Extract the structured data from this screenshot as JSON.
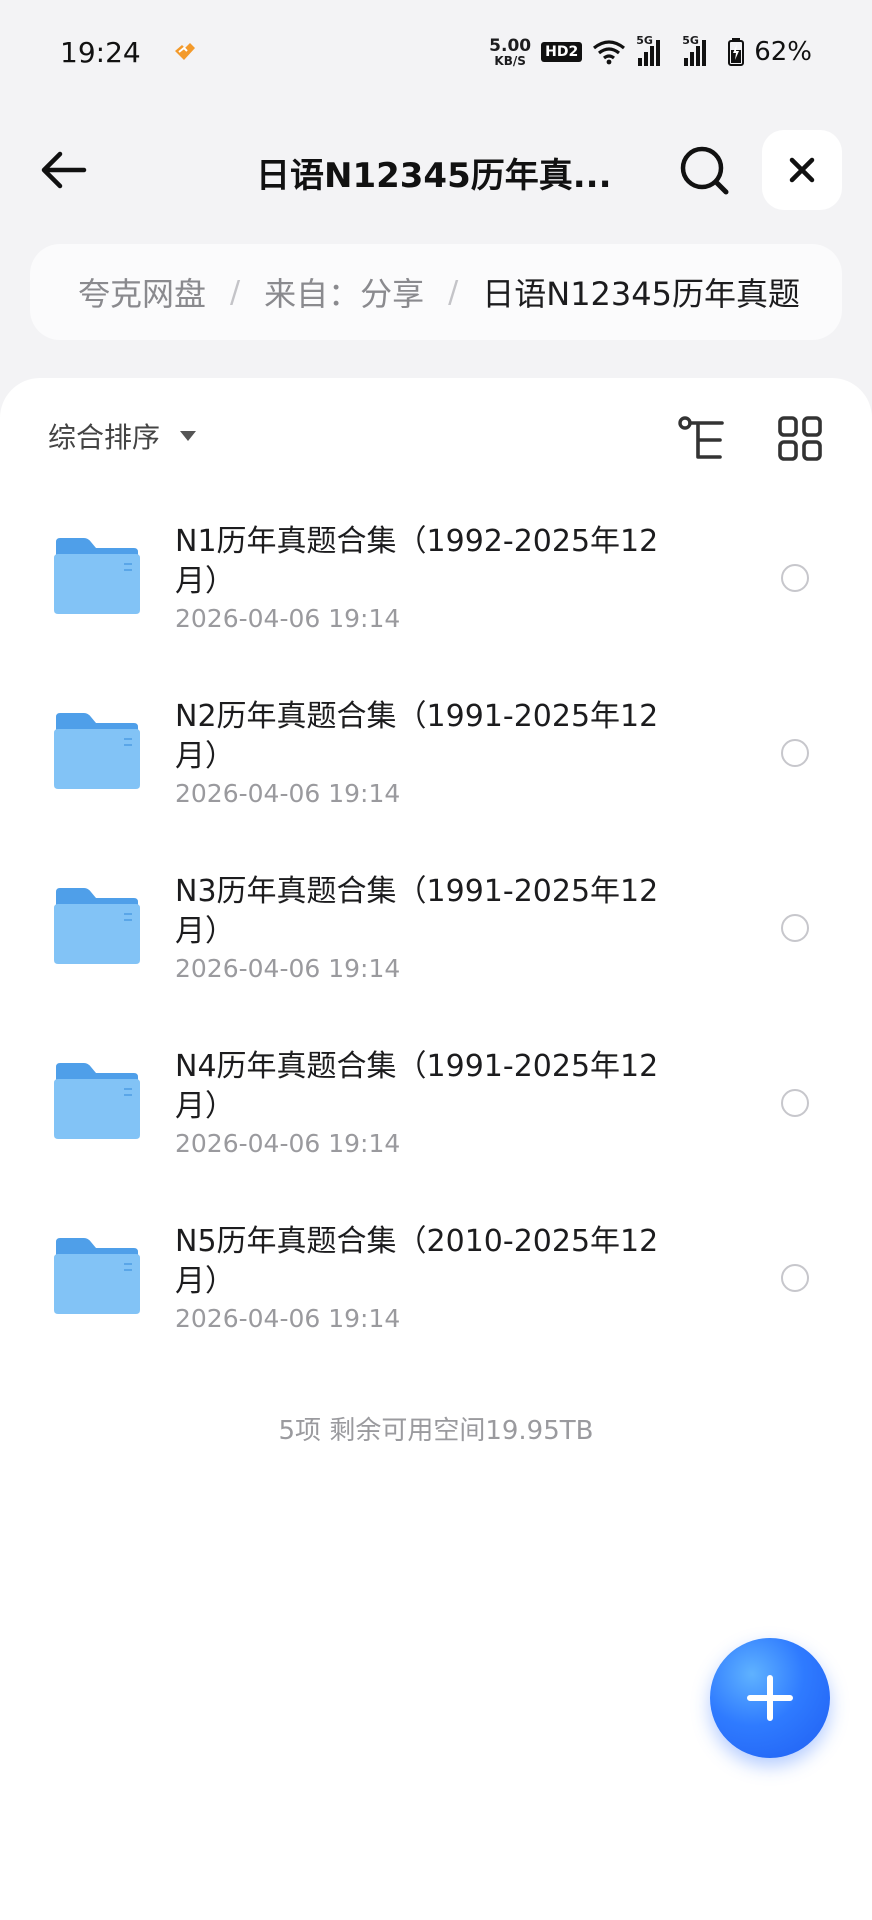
{
  "status_bar": {
    "time": "19:24",
    "net_speed_value": "5.00",
    "net_speed_unit": "KB/S",
    "hd_badge": "HD2",
    "signal1_label": "5G",
    "signal2_label": "5G",
    "battery_percent": "62%"
  },
  "header": {
    "title": "日语N12345历年真..."
  },
  "breadcrumb": {
    "items": [
      "夸克网盘",
      "来自：分享",
      "日语N12345历年真题"
    ],
    "separator": "/"
  },
  "toolbar": {
    "sort_label": "综合排序"
  },
  "files": [
    {
      "name": "N1历年真题合集（1992-2025年12月）",
      "date": "2026-04-06 19:14"
    },
    {
      "name": "N2历年真题合集（1991-2025年12月）",
      "date": "2026-04-06 19:14"
    },
    {
      "name": "N3历年真题合集（1991-2025年12月）",
      "date": "2026-04-06 19:14"
    },
    {
      "name": "N4历年真题合集（1991-2025年12月）",
      "date": "2026-04-06 19:14"
    },
    {
      "name": "N5历年真题合集（2010-2025年12月）",
      "date": "2026-04-06 19:14"
    }
  ],
  "footer": {
    "summary": "5项 剩余可用空间19.95TB"
  },
  "colors": {
    "accent": "#2f7bff",
    "folder": "#6fb7f3",
    "background": "#f3f3f5"
  }
}
